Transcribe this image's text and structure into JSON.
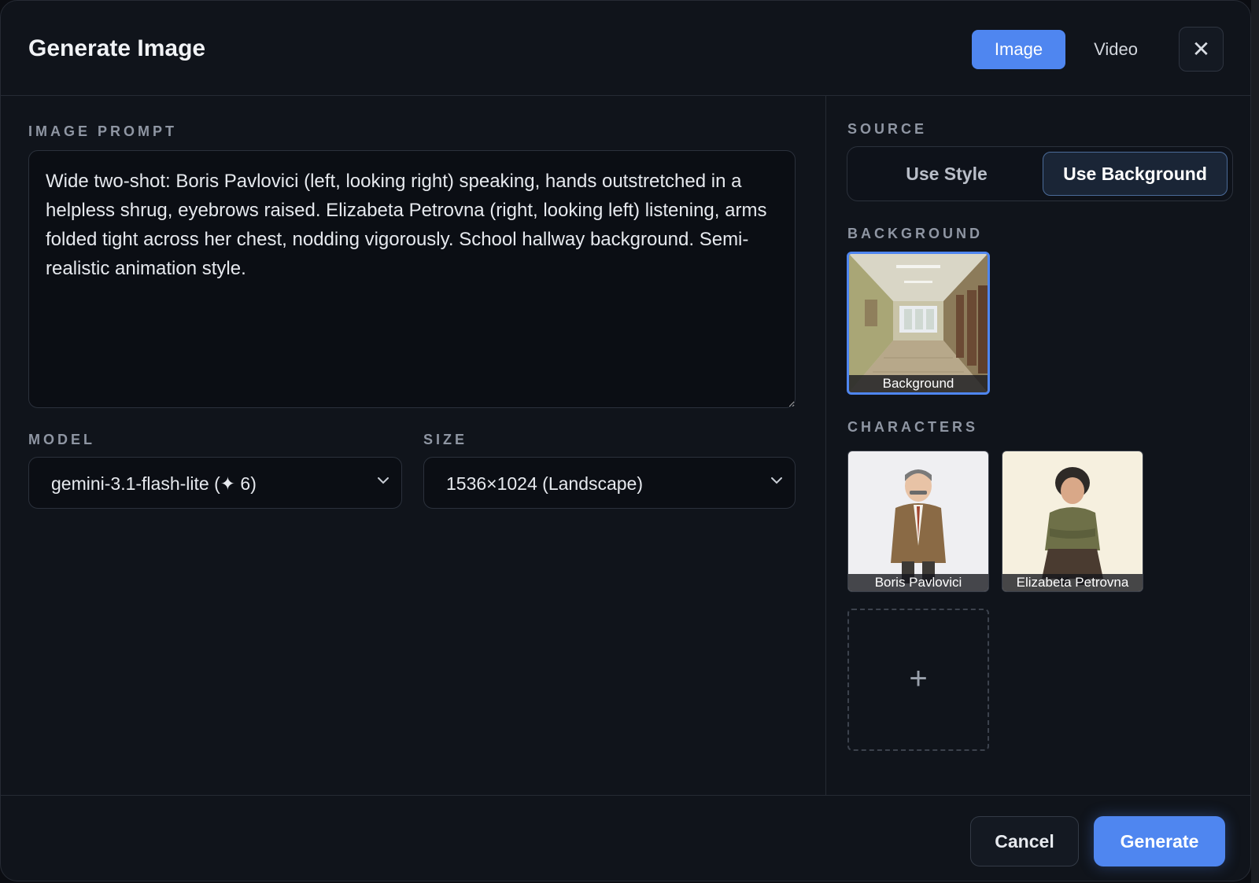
{
  "dialog": {
    "title": "Generate Image",
    "modes": {
      "image": "Image",
      "video": "Video",
      "active": "image"
    },
    "close_icon": "close-icon",
    "close_glyph": "✕"
  },
  "left": {
    "prompt_label": "IMAGE PROMPT",
    "prompt_value": "Wide two-shot: Boris Pavlovici (left, looking right) speaking, hands outstretched in a helpless shrug, eyebrows raised. Elizabeta Petrovna (right, looking left) listening, arms folded tight across her chest, nodding vigorously. School hallway background. Semi-realistic animation style.",
    "model_label": "MODEL",
    "model_value": "gemini-3.1-flash-lite (✦ 6)",
    "size_label": "SIZE",
    "size_value": "1536×1024 (Landscape)"
  },
  "right": {
    "source_label": "SOURCE",
    "source_options": {
      "style": "Use Style",
      "background": "Use Background",
      "active": "background"
    },
    "background_label": "BACKGROUND",
    "background_caption": "Background",
    "characters_label": "CHARACTERS",
    "characters": [
      {
        "name": "Boris Pavlovici"
      },
      {
        "name": "Elizabeta Petrovna"
      }
    ],
    "add_glyph": "+"
  },
  "footer": {
    "cancel": "Cancel",
    "generate": "Generate"
  },
  "colors": {
    "accent": "#4f86f0",
    "panel": "#10141b",
    "border": "#262b34"
  }
}
